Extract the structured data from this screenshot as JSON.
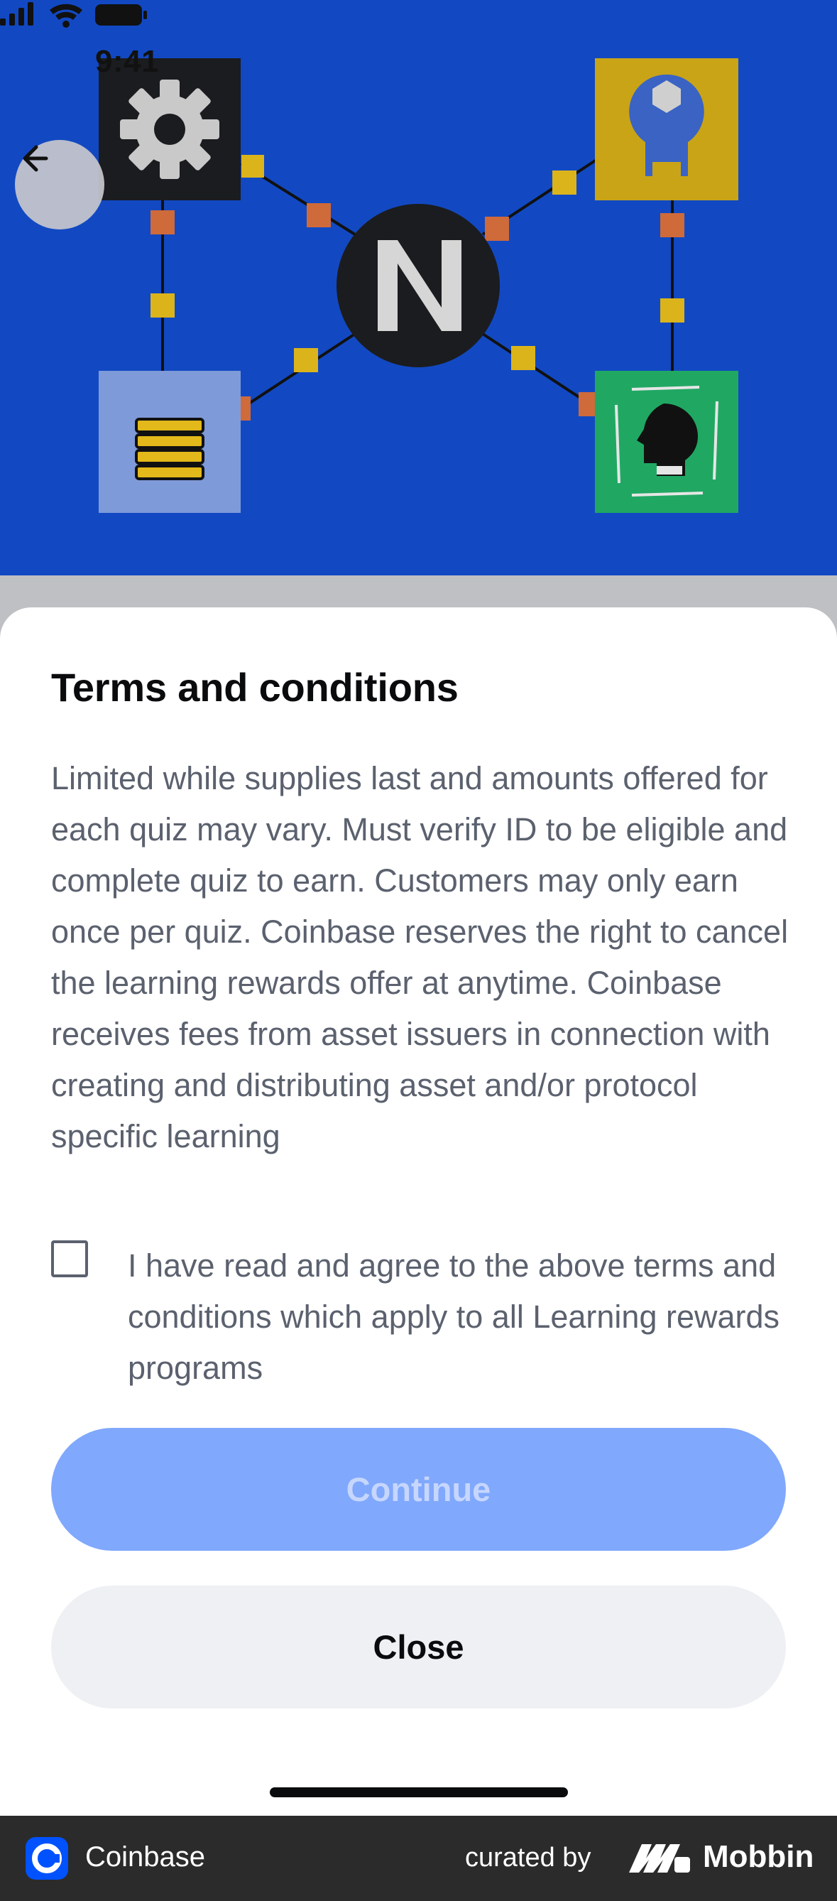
{
  "status_bar": {
    "time": "9:41"
  },
  "hero": {
    "center_logo": "near-protocol-logo"
  },
  "sheet": {
    "title": "Terms and conditions",
    "body": "Limited while supplies last and amounts offered for each quiz may vary. Must verify ID to be eligible and complete quiz to earn. Customers may only earn once per quiz. Coinbase reserves the right to cancel the learning rewards offer at anytime. Coinbase receives fees from asset issuers in connection with creating and distributing asset and/or protocol specific learning",
    "agree_label": "I have read and agree to the above terms and conditions which apply to all Learning rewards programs",
    "agree_checked": false,
    "continue_label": "Continue",
    "close_label": "Close"
  },
  "footer": {
    "app_name": "Coinbase",
    "curated_by": "curated by",
    "brand": "Mobbin"
  },
  "colors": {
    "hero_blue": "#1249c2",
    "continue_disabled": "#80a8fc",
    "close_bg": "#eef0f3",
    "text_secondary": "#5b616e"
  }
}
